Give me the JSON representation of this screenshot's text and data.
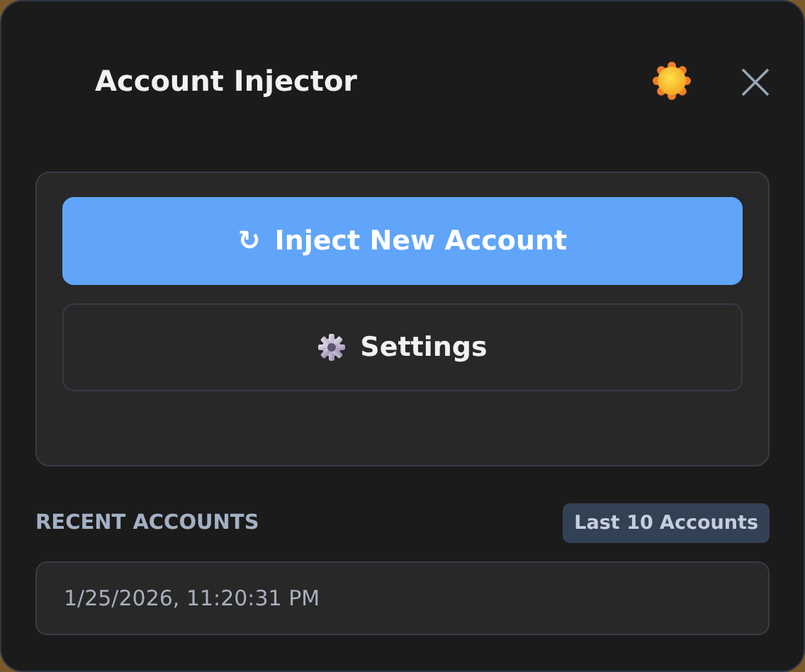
{
  "window": {
    "title": "Account Injector"
  },
  "actions": [
    {
      "kind": "primary",
      "glyph": "↻",
      "label": "Inject New Account"
    },
    {
      "kind": "secondary",
      "label": "Settings"
    }
  ],
  "recent": {
    "heading": "RECENT ACCOUNTS",
    "badge": "Last 10 Accounts",
    "items": [
      {
        "timestamp": "1/25/2026, 11:20:31 PM"
      }
    ]
  }
}
